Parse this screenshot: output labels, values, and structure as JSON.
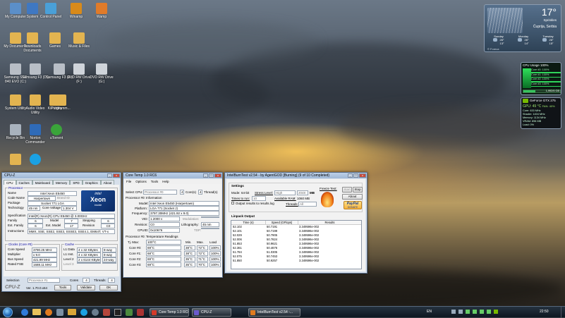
{
  "desktop_icons": [
    {
      "label": "My Computer",
      "icon": "computer-icon"
    },
    {
      "label": "System",
      "icon": "system-icon"
    },
    {
      "label": "Control Panel",
      "icon": "control-panel-icon"
    },
    {
      "label": "Winamp",
      "icon": "winamp-icon"
    },
    {
      "label": "Wamp",
      "icon": "wamp-icon"
    },
    {
      "label": "My Documents",
      "icon": "folder-icon"
    },
    {
      "label": "Downloads Documents",
      "icon": "folder-icon"
    },
    {
      "label": "Games",
      "icon": "folder-icon"
    },
    {
      "label": "Music & Files",
      "icon": "folder-icon"
    },
    {
      "label": "Samsung SSD 840 EVO (C:)",
      "icon": "drive-icon"
    },
    {
      "label": "Samsung F3 (D:)",
      "icon": "drive-icon"
    },
    {
      "label": "Samsung F3 (E:)",
      "icon": "drive-icon"
    },
    {
      "label": "DVD RW Drive (F:)",
      "icon": "dvd-icon"
    },
    {
      "label": "DVD RW Drive (G:)",
      "icon": "dvd-icon"
    },
    {
      "label": "System Utility",
      "icon": "folder-icon"
    },
    {
      "label": "Audio Video Utility",
      "icon": "folder-icon"
    },
    {
      "label": "Kill Utility",
      "icon": "folder-icon"
    },
    {
      "label": "Programm...",
      "icon": "folder-icon"
    },
    {
      "label": "Recycle Bin",
      "icon": "recycle-bin-icon"
    },
    {
      "label": "Norton Commander",
      "icon": "commander-icon"
    },
    {
      "label": "uTorrent",
      "icon": "utorrent-icon"
    },
    {
      "label": "",
      "icon": "folder-icon"
    },
    {
      "label": "",
      "icon": "skype-icon"
    }
  ],
  "weather": {
    "temp": "17°",
    "condition": "Sprinkles",
    "location": "Ćuprija, Serbia",
    "days": [
      {
        "day": "Sunday",
        "hi": "26°",
        "lo": "13°"
      },
      {
        "day": "Monday",
        "hi": "26°",
        "lo": "14°"
      },
      {
        "day": "Tuesday",
        "hi": "26°",
        "lo": "15°"
      }
    ],
    "footer": "© Foreca"
  },
  "cpu_gadget": {
    "title": "CPU Usage",
    "value": "100%",
    "cores": [
      "Core #0: 100%",
      "Core #1: 100%",
      "Core #2: 100%",
      "Core #3: 100%"
    ],
    "ram": "1,992/6 GB"
  },
  "gpu_gadget": {
    "title": "GeForce GTX 275",
    "gpu_label": "GPU: 49 °C",
    "fan": "FAN: 40%",
    "lines": [
      "Core: 633 MHz",
      "Shader: 1404 MHz",
      "Memory: 1134 MHz",
      "VRAM: 896 MB",
      "Load: 0%"
    ]
  },
  "cpuz": {
    "title": "CPU-Z",
    "tabs": [
      "CPU",
      "Caches",
      "Mainboard",
      "Memory",
      "SPD",
      "Graphics",
      "About"
    ],
    "processor_group": "Processor",
    "name_label": "Name",
    "name": "Intel Xeon E5450",
    "codename_label": "Code Name",
    "codename": "Harpertown",
    "brand_label": "Brand ID",
    "package_label": "Package",
    "package": "Socket 771 LGA",
    "technology_label": "Technology",
    "technology": "45 nm",
    "voltage_label": "Core Voltage",
    "voltage": "1.304 V",
    "spec_label": "Specification",
    "spec": "Intel(R) Xeon(R) CPU       E5450  @ 3.00GHz",
    "family_label": "Family",
    "family": "6",
    "model_label": "Model",
    "model": "7",
    "stepping_label": "Stepping",
    "stepping": "6",
    "extfamily_label": "Ext. Family",
    "extfamily": "6",
    "extmodel_label": "Ext. Model",
    "extmodel": "17",
    "revision_label": "Revision",
    "revision": "C0",
    "instr_label": "Instructions",
    "instr": "MMX, SSE, SSE2, SSE3, SSSE3, SSE4.1, EM64T, VT-x",
    "clocks_group": "Clocks (Core #0)",
    "corespeed_label": "Core Speed",
    "corespeed": "3790.25 MHz",
    "multiplier_label": "Multiplier",
    "multiplier": "x 9.0",
    "busspeed_label": "Bus Speed",
    "busspeed": "421.99 MHz",
    "ratedfsb_label": "Rated FSB",
    "ratedfsb": "1688.11 MHz",
    "cache_group": "Cache",
    "l1d_label": "L1 Data",
    "l1d": "4 x 32 KBytes",
    "l1d_way": "8-way",
    "l1i_label": "L1 Inst.",
    "l1i": "4 x 32 KBytes",
    "l1i_way": "8-way",
    "l2_label": "Level 2",
    "l2": "2 x 6144 KBytes",
    "l2_way": "24-way",
    "l3_label": "Level 3",
    "selection_label": "Selection",
    "selection": "Processor #1",
    "cores_label": "Cores",
    "cores": "4",
    "threads_label": "Threads",
    "threads": "4",
    "footer_logo": "CPU-Z",
    "version": "Ver. 1.70.0.x64",
    "tools": "Tools",
    "validate": "Validate",
    "ok": "OK",
    "logo_line1": "intel",
    "logo_line2": "Xeon",
    "logo_line3": "inside"
  },
  "coretemp": {
    "title": "Core Temp 1.0 RC6",
    "menu": [
      "File",
      "Options",
      "Tools",
      "Help"
    ],
    "select_cpu_label": "Select CPU:",
    "select_cpu": "Processor #0",
    "cores_count": "4",
    "cores_word": "Core(s)",
    "threads_count": "4",
    "threads_word": "Thread(s)",
    "info_group": "Processor #0: Information",
    "model_label": "Model:",
    "model": "Intel Xeon E5450 (Harpertown)",
    "platform_label": "Platform:",
    "platform": "LGA 771 (Socket J)",
    "freq_label": "Frequency:",
    "freq": "3797.30MHz (421.92 x 9.0)",
    "vid_label": "VID:",
    "vid": "1.2000 v",
    "mod_label": "Modulation:",
    "rev_label": "Revision:",
    "rev": "C0",
    "litho_label": "Lithography:",
    "litho": "45 nm",
    "cpuid_label": "CPUID:",
    "cpuid": "0x10676",
    "tdp_label": "TDP:",
    "temp_group": "Processor #0: Temperature Readings",
    "tjmax_label": "Tj. Max:",
    "tjmax": "100°C",
    "col_min": "Min.",
    "col_max": "Max.",
    "col_load": "Load",
    "rows": [
      {
        "core": "Core #0:",
        "temp": "69°C",
        "min": "38°C",
        "max": "72°C",
        "load": "100%"
      },
      {
        "core": "Core #1:",
        "temp": "68°C",
        "min": "38°C",
        "max": "72°C",
        "load": "100%"
      },
      {
        "core": "Core #2:",
        "temp": "69°C",
        "min": "35°C",
        "max": "71°C",
        "load": "100%"
      },
      {
        "core": "Core #3:",
        "temp": "69°C",
        "min": "35°C",
        "max": "70°C",
        "load": "100%"
      }
    ]
  },
  "ibt": {
    "title": "IntelBurnTest v2.54 - by AgentGOD [Burning] (9 of 10 Completed)",
    "settings_group": "Settings",
    "mode_label": "Mode:",
    "mode": "64-bit",
    "stress_label": "Stress Level:",
    "stress": "High",
    "mem_value": "2048",
    "mem_unit": "MB",
    "times_label": "Times to run:",
    "times": "10",
    "avail_label": "Available RAM:",
    "avail": "1060 MB",
    "threads_label": "Threads:",
    "threads": "All",
    "output_check": "Output results to results.log",
    "freeze_label": "Freeze Test:",
    "start": "Start",
    "stop": "Stop",
    "about": "About",
    "paypal": "PayPal",
    "donate": "DONATE",
    "linpack_group": "Linpack Output",
    "col_time": "Time (s)",
    "col_speed": "Speed (GFlops)",
    "col_results": "Results",
    "rows": [
      {
        "time": "52.102",
        "speed": "50.7191",
        "result": "3.349596e-002"
      },
      {
        "time": "52.101",
        "speed": "50.7199",
        "result": "3.349596e-002"
      },
      {
        "time": "52.029",
        "speed": "50.7905",
        "result": "3.349596e-002"
      },
      {
        "time": "52.006",
        "speed": "50.7824",
        "result": "3.349596e-002"
      },
      {
        "time": "51.853",
        "speed": "50.9621",
        "result": "3.349596e-002"
      },
      {
        "time": "52.361",
        "speed": "50.4676",
        "result": "3.349596e-002"
      },
      {
        "time": "51.784",
        "speed": "51.0305",
        "result": "3.349596e-002"
      },
      {
        "time": "52.075",
        "speed": "50.7453",
        "result": "3.349596e-002"
      },
      {
        "time": "51.850",
        "speed": "50.9257",
        "result": "3.349596e-002"
      }
    ]
  },
  "taskbar": {
    "buttons": [
      "Core Temp 1.0 RC6",
      "CPU-Z",
      "IntelBurnTest v2.54 -..."
    ],
    "lang": "EN",
    "clock": "22:50"
  }
}
